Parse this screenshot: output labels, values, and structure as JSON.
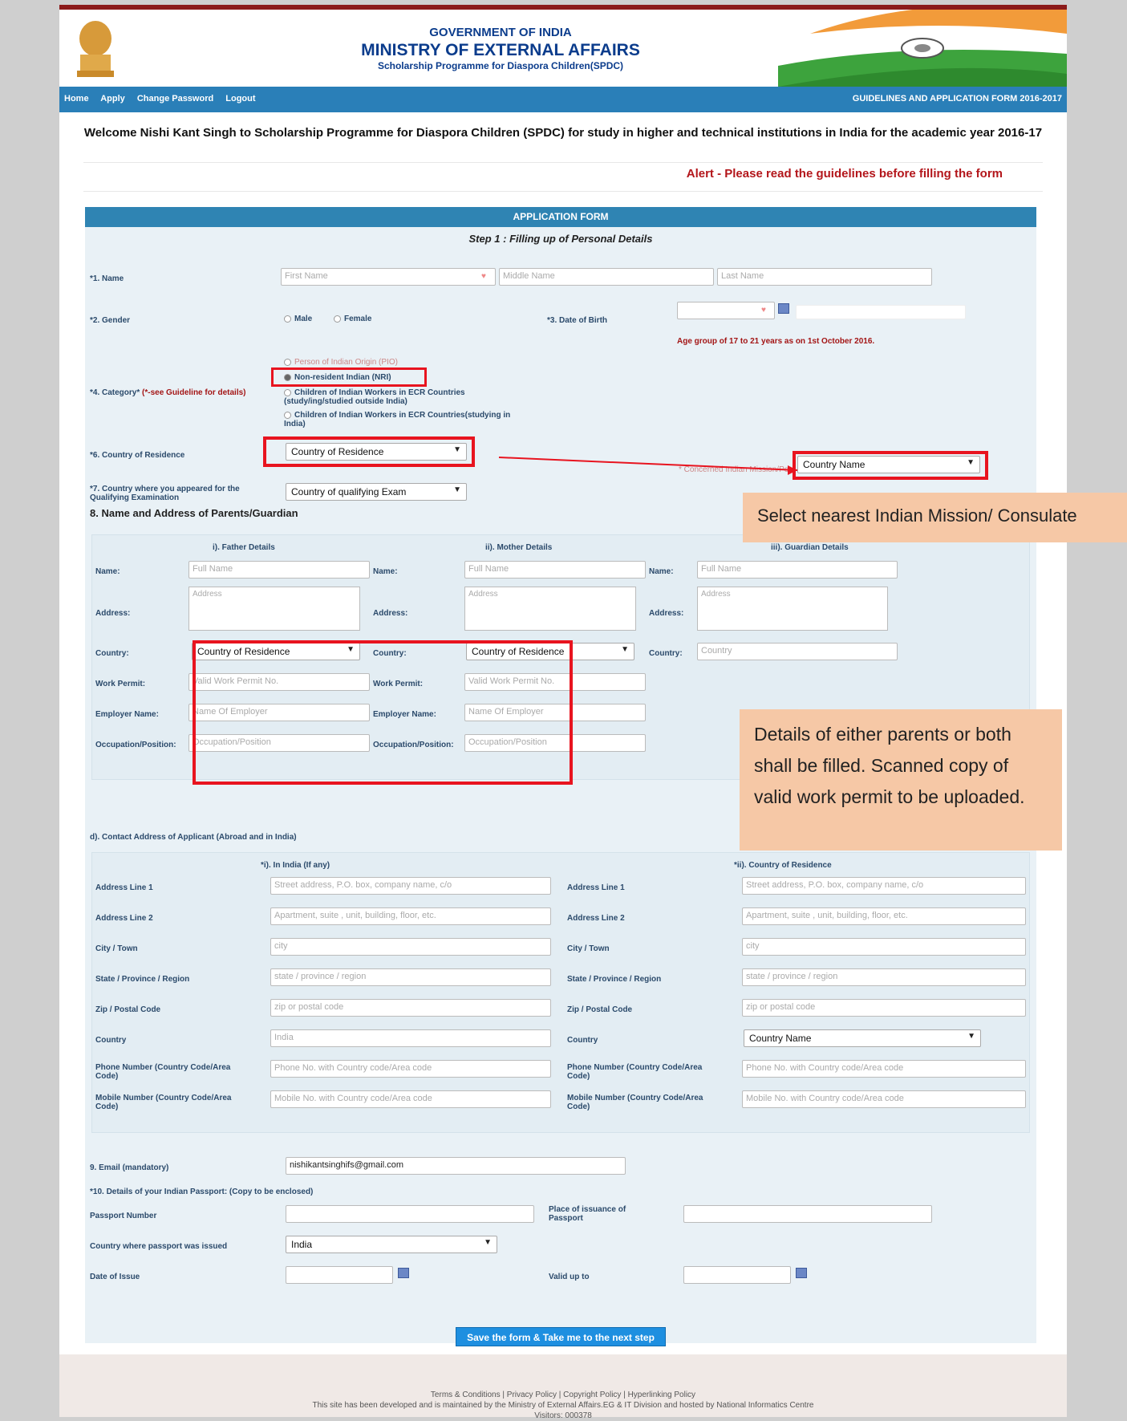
{
  "header": {
    "line1": "GOVERNMENT OF INDIA",
    "line2": "MINISTRY OF EXTERNAL AFFAIRS",
    "line3": "Scholarship Programme for Diaspora Children(SPDC)"
  },
  "nav": {
    "items": [
      "Home",
      "Apply",
      "Change Password",
      "Logout"
    ],
    "right": "GUIDELINES AND APPLICATION FORM 2016-2017"
  },
  "welcome": "Welcome Nishi Kant Singh to Scholarship Programme for Diaspora Children (SPDC) for study in higher and technical institutions in India for the academic year 2016-17",
  "alert": "Alert - Please read the guidelines before filling the form",
  "form": {
    "title": "APPLICATION FORM",
    "step": "Step 1 : Filling up of Personal Details",
    "name_label": "*1. Name",
    "first_ph": "First Name",
    "middle_ph": "Middle Name",
    "last_ph": "Last Name",
    "gender_label": "*2. Gender",
    "male": "Male",
    "female": "Female",
    "dob_label": "*3. Date of Birth",
    "age_note": "Age group of 17 to 21 years as on 1st October 2016.",
    "category_label": "*4. Category*",
    "category_note": "(*-see Guideline for details)",
    "cat_options": [
      "Person of Indian Origin (PIO)",
      "Non-resident Indian (NRI)",
      "Children of Indian Workers in ECR Countries (study/ing/studied outside India)",
      "Children of Indian Workers in ECR Countries(studying in India)"
    ],
    "residence_label": "*6. Country of Residence",
    "residence_sel": "Country of Residence",
    "mission_label": "* Concerned Indian Mission/Post",
    "mission_sel": "Country Name",
    "qualify_label": "*7. Country where you appeared for the Qualifying Examination",
    "qualify_sel": "Country of qualifying Exam",
    "parents_title": "8. Name and Address of Parents/Guardian",
    "father_head": "i). Father Details",
    "mother_head": "ii). Mother Details",
    "guardian_head": "iii). Guardian Details",
    "name_l": "Name:",
    "address_l": "Address:",
    "country_l": "Country:",
    "work_l": "Work Permit:",
    "employer_l": "Employer Name:",
    "occ_l": "Occupation/Position:",
    "fullname_ph": "Full Name",
    "address_ph": "Address",
    "country_res": "Country of Residence",
    "country_ph": "Country",
    "work_ph": "Valid Work Permit No.",
    "employer_ph": "Name Of Employer",
    "occ_ph": "Occupation/Position",
    "contact_title": "d). Contact Address of Applicant (Abroad and in India)",
    "india_head": "*i). In India (If any)",
    "cor_head": "*ii). Country of Residence",
    "addr1_l": "Address Line 1",
    "addr2_l": "Address Line 2",
    "city_l": "City / Town",
    "state_l": "State / Province / Region",
    "zip_l": "Zip / Postal Code",
    "country2_l": "Country",
    "phone_l": "Phone Number (Country Code/Area Code)",
    "mobile_l": "Mobile Number (Country Code/Area Code)",
    "addr1_ph": "Street address, P.O. box, company name, c/o",
    "addr2_ph": "Apartment, suite , unit, building, floor, etc.",
    "city_ph": "city",
    "state_ph": "state / province / region",
    "zip_ph": "zip or postal code",
    "country_india": "India",
    "country_name": "Country Name",
    "phone_ph": "Phone No. with Country code/Area code",
    "mobile_ph": "Mobile No. with Country code/Area code",
    "email_label": "9. Email (mandatory)",
    "email_val": "nishikantsinghifs@gmail.com",
    "passport_title": "*10. Details of your Indian Passport: (Copy to be enclosed)",
    "passport_no": "Passport Number",
    "place_issue": "Place of issuance of Passport",
    "country_issue": "Country where passport was issued",
    "country_issue_val": "India",
    "date_issue": "Date of Issue",
    "valid_upto": "Valid up to",
    "save": "Save the form & Take me to the next step"
  },
  "callouts": {
    "mission": "Select nearest Indian Mission/ Consulate",
    "parents": "Details of either parents or both shall be filled. Scanned copy of valid work permit to be uploaded."
  },
  "footer": {
    "links": "Terms & Conditions | Privacy Policy | Copyright Policy | Hyperlinking Policy",
    "dev": "This site has been developed and is maintained by the Ministry of External Affairs.EG & IT Division and hosted by National Informatics Centre",
    "visitors": "Visitors: 000378"
  },
  "colors": {
    "nav": "#2a7fb8",
    "alert": "#b3161b",
    "highlight": "#e8141f",
    "callout": "#f6c8a6"
  }
}
